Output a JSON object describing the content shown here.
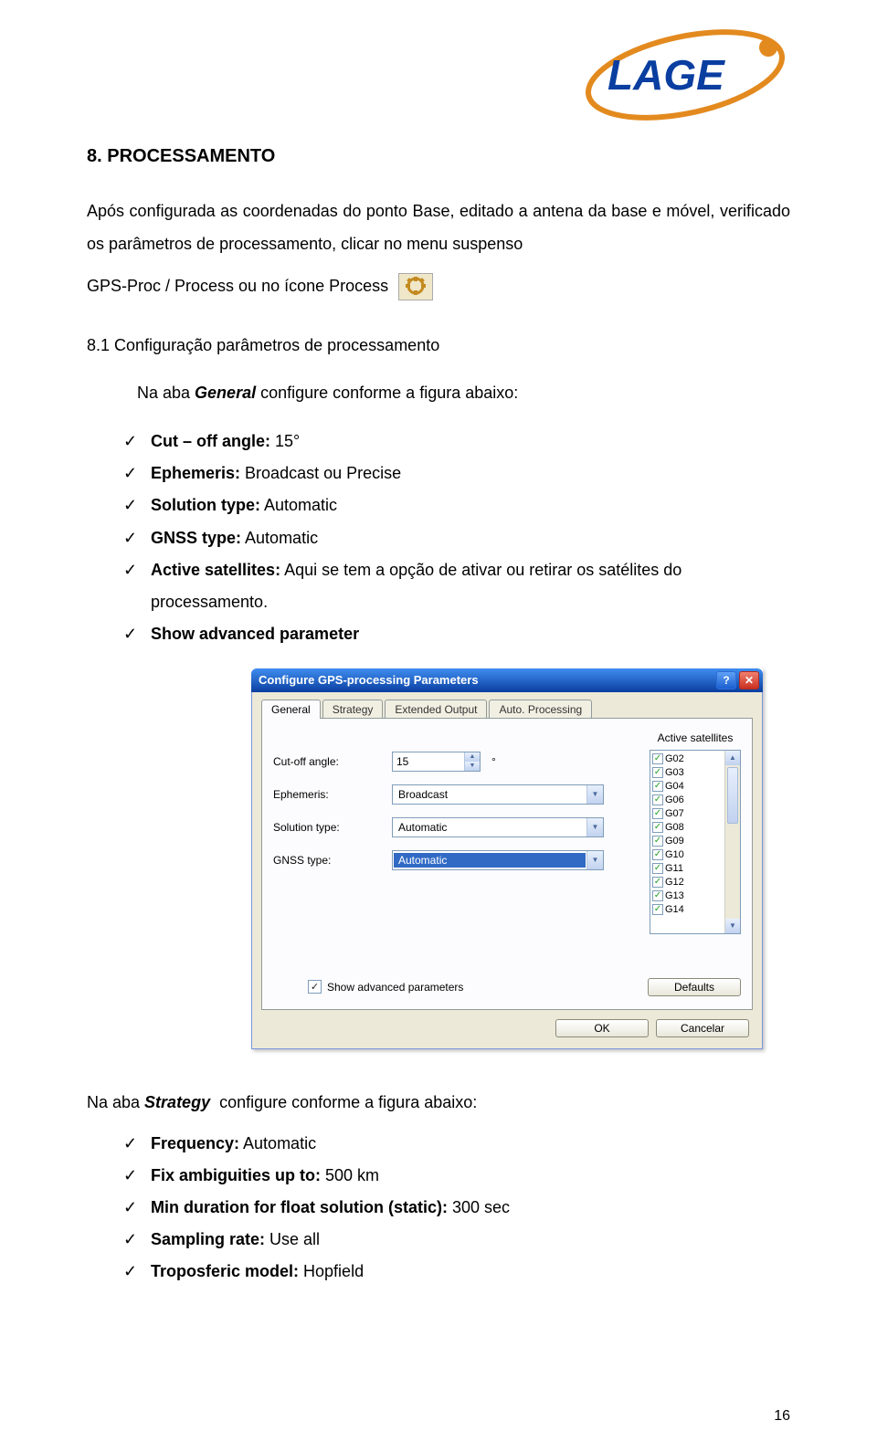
{
  "logo_text": "LAGE",
  "heading": "8. PROCESSAMENTO",
  "intro_paragraph": "Após configurada as coordenadas do ponto Base, editado a antena da base e móvel, verificado os parâmetros de processamento, clicar no menu suspenso",
  "intro_line2": "GPS-Proc / Process ou no ícone Process",
  "subheading": "8.1 Configuração parâmetros de processamento",
  "subheading_text": "Na aba General configure conforme a figura abaixo:",
  "checks": [
    {
      "label_bold": "Cut – off angle:",
      "label_rest": " 15°"
    },
    {
      "label_bold": "Ephemeris:",
      "label_rest": " Broadcast ou Precise"
    },
    {
      "label_bold": "Solution type:",
      "label_rest": " Automatic"
    },
    {
      "label_bold": "GNSS type:",
      "label_rest": " Automatic"
    },
    {
      "label_bold": "Active satellites:",
      "label_rest": " Aqui se tem a opção de ativar ou retirar os satélites do"
    },
    {
      "label_bold": "Show advanced parameter",
      "label_rest": ""
    }
  ],
  "check_cont": "processamento.",
  "dialog": {
    "title": "Configure GPS-processing Parameters",
    "tabs": [
      "General",
      "Strategy",
      "Extended Output",
      "Auto. Processing"
    ],
    "labels": {
      "cutoff": "Cut-off angle:",
      "ephemeris": "Ephemeris:",
      "solution": "Solution type:",
      "gnss": "GNSS type:",
      "active_sat": "Active satellites"
    },
    "values": {
      "cutoff": "15",
      "ephemeris": "Broadcast",
      "solution": "Automatic",
      "gnss": "Automatic"
    },
    "satellites": [
      "G02",
      "G03",
      "G04",
      "G06",
      "G07",
      "G08",
      "G09",
      "G10",
      "G11",
      "G12",
      "G13",
      "G14"
    ],
    "adv_label": "Show advanced parameters",
    "defaults_btn": "Defaults",
    "ok_btn": "OK",
    "cancel_btn": "Cancelar"
  },
  "strategy_intro": "Na aba Strategy  configure conforme a figura abaixo:",
  "strategy_checks": [
    {
      "label_bold": "Frequency:",
      "label_rest": " Automatic"
    },
    {
      "label_bold": "Fix ambiguities up to:",
      "label_rest": " 500 km"
    },
    {
      "label_bold": "Min duration for float solution (static):",
      "label_rest": " 300 sec"
    },
    {
      "label_bold": "Sampling rate:",
      "label_rest": " Use all"
    },
    {
      "label_bold": "Troposferic model:",
      "label_rest": " Hopfield"
    }
  ],
  "page_number": "16"
}
